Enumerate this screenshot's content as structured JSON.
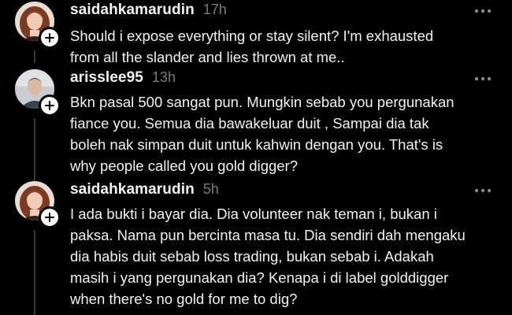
{
  "icons": {
    "follow": "plus-icon",
    "more": "more-horizontal-icon"
  },
  "colors": {
    "background": "#000000",
    "text": "#f2f2f2",
    "muted": "#7a7a7a",
    "thread_line": "#3a3a3a"
  },
  "posts": [
    {
      "username": "saidahkamarudin",
      "time": "17h",
      "lines": [
        "Should i expose everything or stay silent? I'm exhausted",
        "from all the slander and lies thrown at me.."
      ]
    },
    {
      "username": "arisslee95",
      "time": "13h",
      "lines": [
        "Bkn pasal 500 sangat pun. Mungkin  sebab you pergunakan",
        "fiance you. Semua dia bawakeluar duit , Sampai dia tak",
        "boleh nak simpan duit untuk kahwin dengan you. That's is",
        "why people called you gold digger?"
      ]
    },
    {
      "username": "saidahkamarudin",
      "time": "5h",
      "lines": [
        "I ada bukti i bayar dia. Dia volunteer nak teman i, bukan i",
        "paksa. Nama pun bercinta masa tu. Dia sendiri dah mengaku",
        "dia habis duit sebab loss trading, bukan sebab i. Adakah",
        "masih i yang pergunakan dia? Kenapa i di label golddigger",
        "when there's no gold for me to dig?"
      ]
    }
  ]
}
